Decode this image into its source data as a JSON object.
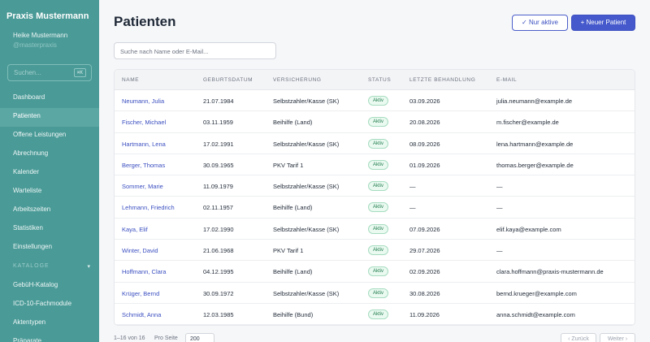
{
  "sidebar": {
    "brand": "Praxis Mustermann",
    "user_name": "Heike Mustermann",
    "user_handle": "@masterpraxis",
    "search_placeholder": "Suchen...",
    "search_shortcut": "⌘K",
    "items": [
      {
        "label": "Dashboard"
      },
      {
        "label": "Patienten",
        "active": true
      },
      {
        "label": "Offene Leistungen"
      },
      {
        "label": "Abrechnung"
      },
      {
        "label": "Kalender"
      },
      {
        "label": "Warteliste"
      },
      {
        "label": "Arbeitszeiten"
      },
      {
        "label": "Statistiken"
      },
      {
        "label": "Einstellungen"
      }
    ],
    "section_title": "KATALOGE",
    "section_caret": "▾",
    "section_items": [
      {
        "label": "GebüH-Katalog"
      },
      {
        "label": "ICD-10-Fachmodule"
      },
      {
        "label": "Aktentypen"
      },
      {
        "label": "Präparate"
      }
    ]
  },
  "header": {
    "title": "Patienten",
    "filter_button": "✓ Nur aktive",
    "new_button": "+ Neuer Patient"
  },
  "search": {
    "placeholder": "Suche nach Name oder E-Mail..."
  },
  "table": {
    "columns": [
      "NAME",
      "GEBURTSDATUM",
      "VERSICHERUNG",
      "STATUS",
      "LETZTE BEHANDLUNG",
      "E-MAIL"
    ],
    "rows": [
      {
        "name": "Neumann, Julia",
        "birth": "21.07.1984",
        "insurance": "Selbstzahler/Kasse (SK)",
        "status": "Aktiv",
        "last": "03.09.2026",
        "email": "julia.neumann@example.de"
      },
      {
        "name": "Fischer, Michael",
        "birth": "03.11.1959",
        "insurance": "Beihilfe (Land)",
        "status": "Aktiv",
        "last": "20.08.2026",
        "email": "m.fischer@example.de"
      },
      {
        "name": "Hartmann, Lena",
        "birth": "17.02.1991",
        "insurance": "Selbstzahler/Kasse (SK)",
        "status": "Aktiv",
        "last": "08.09.2026",
        "email": "lena.hartmann@example.de"
      },
      {
        "name": "Berger, Thomas",
        "birth": "30.09.1965",
        "insurance": "PKV Tarif 1",
        "status": "Aktiv",
        "last": "01.09.2026",
        "email": "thomas.berger@example.de"
      },
      {
        "name": "Sommer, Marie",
        "birth": "11.09.1979",
        "insurance": "Selbstzahler/Kasse (SK)",
        "status": "Aktiv",
        "last": "—",
        "email": "—"
      },
      {
        "name": "Lehmann, Friedrich",
        "birth": "02.11.1957",
        "insurance": "Beihilfe (Land)",
        "status": "Aktiv",
        "last": "—",
        "email": "—"
      },
      {
        "name": "Kaya, Elif",
        "birth": "17.02.1990",
        "insurance": "Selbstzahler/Kasse (SK)",
        "status": "Aktiv",
        "last": "07.09.2026",
        "email": "elif.kaya@example.com"
      },
      {
        "name": "Winter, David",
        "birth": "21.06.1968",
        "insurance": "PKV Tarif 1",
        "status": "Aktiv",
        "last": "29.07.2026",
        "email": "—"
      },
      {
        "name": "Hoffmann, Clara",
        "birth": "04.12.1995",
        "insurance": "Beihilfe (Land)",
        "status": "Aktiv",
        "last": "02.09.2026",
        "email": "clara.hoffmann@praxis-mustermann.de"
      },
      {
        "name": "Krüger, Bernd",
        "birth": "30.09.1972",
        "insurance": "Selbstzahler/Kasse (SK)",
        "status": "Aktiv",
        "last": "30.08.2026",
        "email": "bernd.krueger@example.com"
      },
      {
        "name": "Schmidt, Anna",
        "birth": "12.03.1985",
        "insurance": "Beihilfe (Bund)",
        "status": "Aktiv",
        "last": "11.09.2026",
        "email": "anna.schmidt@example.com"
      }
    ]
  },
  "footer": {
    "count": "1–16 von 16",
    "per_page_label": "Pro Seite",
    "per_page_value": "200",
    "prev": "‹ Zurück",
    "next": "Weiter ›"
  },
  "colors": {
    "sidebar": "#4a9a97",
    "primary": "#4559cc",
    "link": "#3b4fc0",
    "status_bg": "#eafaf1"
  }
}
